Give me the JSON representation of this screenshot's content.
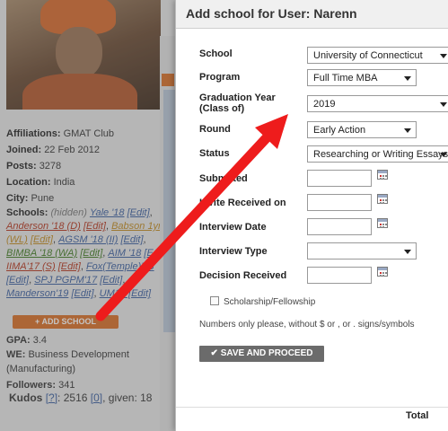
{
  "profile": {
    "affiliations_label": "Affiliations:",
    "affiliations": "GMAT Club",
    "joined_label": "Joined:",
    "joined": "22 Feb 2012",
    "posts_label": "Posts:",
    "posts": "3278",
    "location_label": "Location:",
    "location": "India",
    "city_label": "City:",
    "city": "Pune",
    "schools_label": "Schools:",
    "schools_hidden": "(hidden)",
    "schools": [
      {
        "name": "Yale '18",
        "edit": "[Edit]"
      },
      {
        "name": "Anderson '18 (D)",
        "edit": "[Edit]"
      },
      {
        "name": "Babson 1yr'17 (WL)",
        "edit": "[Edit]"
      },
      {
        "name": "AGSM '18 (II)",
        "edit": "[Edit]"
      },
      {
        "name": "BIMBA '18 (WA)",
        "edit": "[Edit]"
      },
      {
        "name": "AIM '18",
        "edit": "[Edit]"
      },
      {
        "name": "IIMA'17 (S)",
        "edit": "[Edit]"
      },
      {
        "name": "Fox(Temple)'18",
        "edit": "[Edit]"
      },
      {
        "name": "SPJ PGPM'17",
        "edit": "[Edit]"
      },
      {
        "name": "Manderson'19",
        "edit": "[Edit]"
      },
      {
        "name": "UM",
        "edit": "19 [Edit]"
      }
    ],
    "add_school_label": "+ ADD SCHOOL",
    "gpa_label": "GPA:",
    "gpa": "3.4",
    "we_label": "WE:",
    "we": "Business Development (Manufacturing)",
    "followers_label": "Followers:",
    "followers": "341",
    "kudos_label": "Kudos",
    "kudos_q": "[?]",
    "kudos_value": "2516",
    "kudos_count": "[0]",
    "kudos_given": ", given: 18"
  },
  "modal": {
    "title": "Add school for User: Narenn",
    "fields": {
      "school": {
        "label": "School",
        "value": "University of Connecticut"
      },
      "program": {
        "label": "Program",
        "value": "Full Time MBA"
      },
      "graduation_year": {
        "label": "Graduation Year (Class of)",
        "value": "2019"
      },
      "round": {
        "label": "Round",
        "value": "Early Action"
      },
      "status": {
        "label": "Status",
        "value": "Researching or Writing Essays"
      },
      "submitted": {
        "label": "Submitted",
        "value": ""
      },
      "invite_received_on": {
        "label": "Invite Received on",
        "value": ""
      },
      "interview_date": {
        "label": "Interview Date",
        "value": ""
      },
      "interview_type": {
        "label": "Interview Type",
        "value": ""
      },
      "decision_received": {
        "label": "Decision Received",
        "value": ""
      }
    },
    "scholarship_label": "Scholarship/Fellowship",
    "note": "Numbers only please, without $ or , or . signs/symbols",
    "save_label": "SAVE AND PROCEED",
    "total_label": "Total"
  },
  "colors": {
    "arrow": "#ee1c1c",
    "add_school_button": "#d96d24",
    "save_button": "#6b6b6b"
  }
}
